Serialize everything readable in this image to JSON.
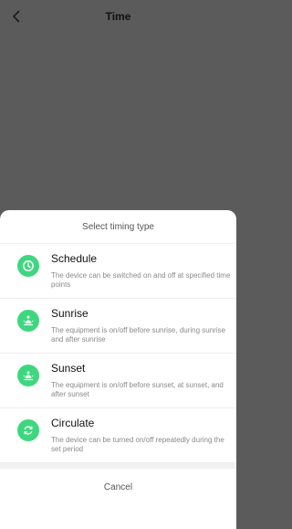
{
  "header": {
    "title": "Time"
  },
  "sheet": {
    "heading": "Select timing type",
    "options": [
      {
        "title": "Schedule",
        "desc": "The device can be switched on and off at specified time points",
        "icon": "clock-icon"
      },
      {
        "title": "Sunrise",
        "desc": "The equipment is on/off before sunrise, during sunrise and after sunrise",
        "icon": "sunrise-icon"
      },
      {
        "title": "Sunset",
        "desc": "The equipment is on/off before sunset, at sunset, and after sunset",
        "icon": "sunset-icon"
      },
      {
        "title": "Circulate",
        "desc": "The device can be turned on/off repeatedly during the set period",
        "icon": "cycle-icon"
      }
    ],
    "cancel": "Cancel"
  },
  "colors": {
    "accent": "#3ed77f",
    "backdrop": "#5b5b5b"
  }
}
